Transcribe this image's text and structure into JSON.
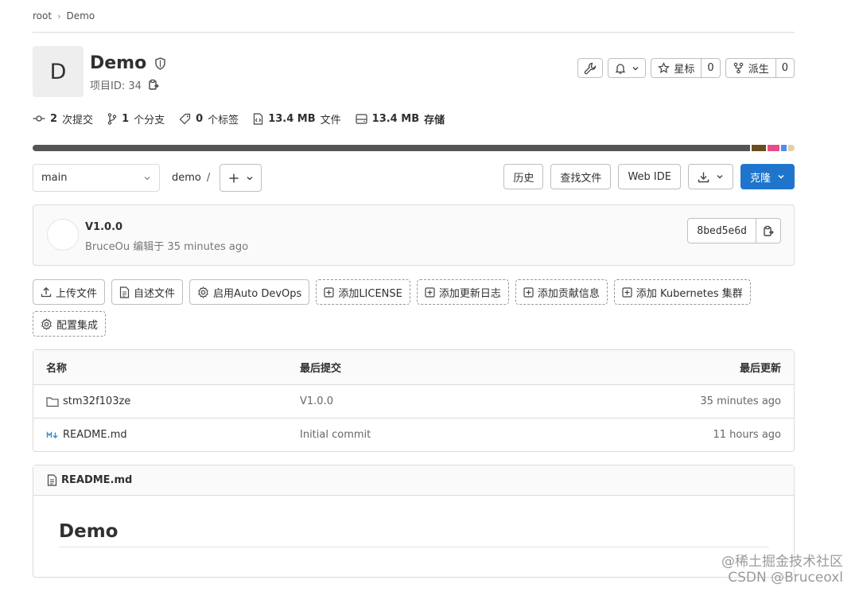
{
  "breadcrumb": {
    "root": "root",
    "project": "Demo"
  },
  "project": {
    "avatar_letter": "D",
    "name": "Demo",
    "id_label": "项目ID: 34"
  },
  "header_actions": {
    "star_label": "星标",
    "star_count": "0",
    "fork_label": "派生",
    "fork_count": "0"
  },
  "stats": {
    "commits_num": "2",
    "commits_label": "次提交",
    "branches_num": "1",
    "branches_label": "个分支",
    "tags_num": "0",
    "tags_label": "个标签",
    "files_num": "13.4 MB",
    "files_label": "文件",
    "storage_num": "13.4 MB",
    "storage_label": "存储"
  },
  "language_bar": [
    {
      "percent": 94.4,
      "color": "#555555"
    },
    {
      "percent": 1.9,
      "color": "#6b4c1e"
    },
    {
      "percent": 1.5,
      "color": "#e84d8a"
    },
    {
      "percent": 0.8,
      "color": "#4e8cf0"
    },
    {
      "percent": 0.8,
      "color": "#e4cfa3"
    }
  ],
  "toolbar": {
    "branch": "main",
    "path": "demo",
    "path_sep": "/",
    "history": "历史",
    "find_file": "查找文件",
    "web_ide": "Web IDE",
    "clone": "克隆"
  },
  "commit": {
    "title": "V1.0.0",
    "author": "BruceOu",
    "action": "编辑于",
    "time": "35 minutes ago",
    "sha": "8bed5e6d"
  },
  "quick_actions": {
    "upload": "上传文件",
    "readme": "自述文件",
    "autodevops": "启用Auto DevOps",
    "license": "添加LICENSE",
    "changelog": "添加更新日志",
    "contributing": "添加贡献信息",
    "kubernetes": "添加 Kubernetes 集群",
    "ci": "配置集成"
  },
  "files": {
    "headers": {
      "name": "名称",
      "last_commit": "最后提交",
      "last_update": "最后更新"
    },
    "rows": [
      {
        "name": "stm32f103ze",
        "commit": "V1.0.0",
        "updated": "35 minutes ago",
        "icon": "folder-icon"
      },
      {
        "name": "README.md",
        "commit": "Initial commit",
        "updated": "11 hours ago",
        "icon": "markdown-icon"
      }
    ]
  },
  "readme": {
    "filename": "README.md",
    "heading": "Demo"
  },
  "watermark": {
    "line1": "@稀土掘金技术社区",
    "line2": "CSDN @Bruceoxl"
  }
}
